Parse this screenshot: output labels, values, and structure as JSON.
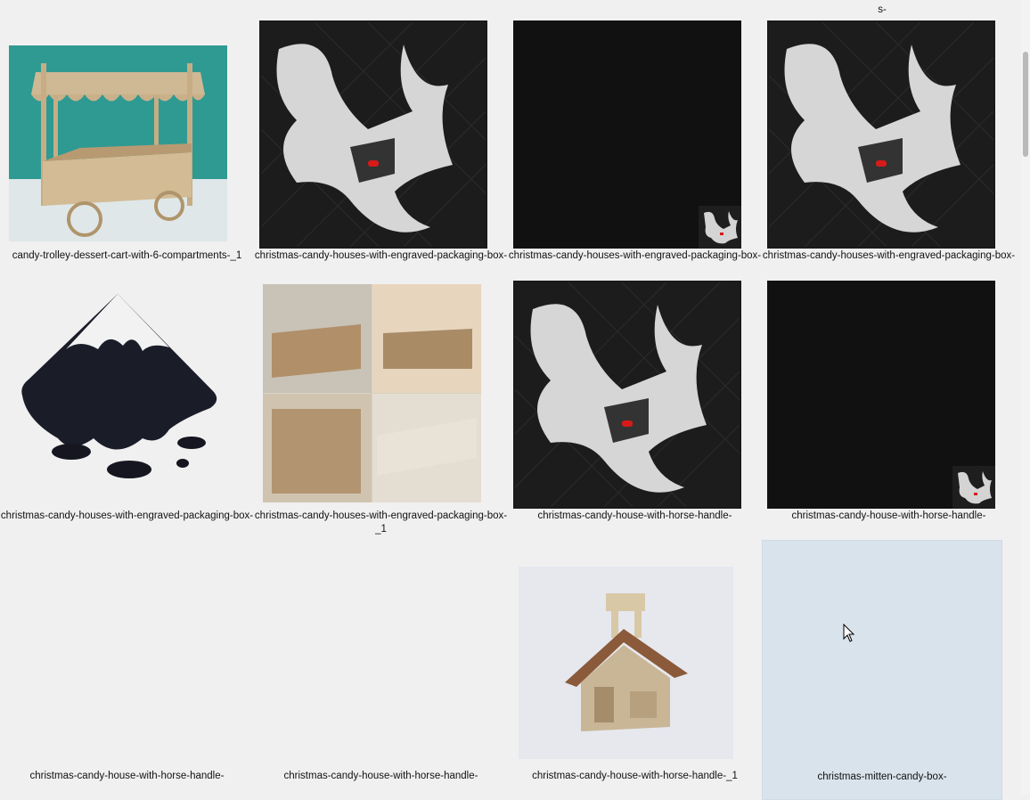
{
  "top_label": "s-",
  "items": [
    {
      "name": "candy-trolley-dessert-cart-with-6-compartments-_1",
      "icon": "cart-photo"
    },
    {
      "name": "christmas-candy-houses-with-engraved-packaging-box-",
      "icon": "rhino-icon"
    },
    {
      "name": "christmas-candy-houses-with-engraved-packaging-box-",
      "icon": "rhino-small-icon"
    },
    {
      "name": "christmas-candy-houses-with-engraved-packaging-box-",
      "icon": "rhino-icon"
    },
    {
      "name": "christmas-candy-houses-with-engraved-packaging-box-",
      "icon": "inkscape-icon"
    },
    {
      "name": "christmas-candy-houses-with-engraved-packaging-box-_1",
      "icon": "candy-houses-photo"
    },
    {
      "name": "christmas-candy-house-with-horse-handle-",
      "icon": "rhino-icon"
    },
    {
      "name": "christmas-candy-house-with-horse-handle-",
      "icon": "rhino-small-icon"
    },
    {
      "name": "christmas-candy-house-with-horse-handle-",
      "icon": "blank"
    },
    {
      "name": "christmas-candy-house-with-horse-handle-",
      "icon": "blank"
    },
    {
      "name": "christmas-candy-house-with-horse-handle-_1",
      "icon": "house-render-photo"
    },
    {
      "name": "christmas-mitten-candy-box-",
      "icon": "blank"
    }
  ]
}
